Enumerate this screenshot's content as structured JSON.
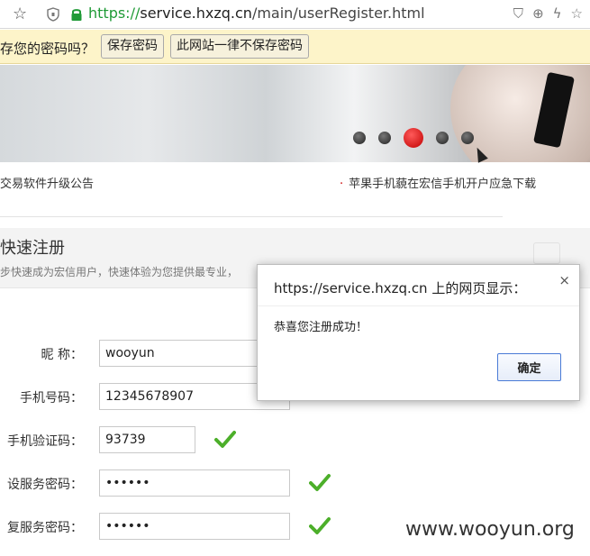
{
  "browser": {
    "url_scheme": "https://",
    "url_host": "service.hxzq.cn",
    "url_path": "/main/userRegister.html",
    "icons": [
      "star-icon",
      "shield-icon",
      "lock-icon",
      "reader-shield-icon",
      "zoom-icon",
      "bolt-icon",
      "bookmark-star-icon"
    ]
  },
  "password_bar": {
    "question": "存您的密码吗？",
    "save_label": "保存密码",
    "never_label": "此网站一律不保存密码"
  },
  "banner": {
    "slides": 5,
    "active_slide_index": 2
  },
  "notices": {
    "left": "交易软件升级公告",
    "right": "苹果手机藐在宏信手机开户应急下载"
  },
  "section": {
    "title": "快速注册",
    "subtitle": "步快速成为宏信用户，快速体验为您提供最专业，"
  },
  "form": {
    "nickname_label": "昵 称：",
    "nickname_value": "wooyun",
    "phone_label": "手机号码：",
    "phone_value": "12345678907",
    "code_label": "手机验证码：",
    "code_value": "93739",
    "pwd_label": "设服务密码：",
    "pwd_value": "••••••",
    "pwd2_label": "复服务密码：",
    "pwd2_value": "••••••"
  },
  "dialog": {
    "title": "https://service.hxzq.cn 上的网页显示：",
    "message": "恭喜您注册成功！",
    "ok_label": "确定",
    "close_glyph": "×"
  },
  "watermark": "www.wooyun.org",
  "colors": {
    "https_green": "#1f9a36",
    "check_green": "#4caf2a",
    "active_dot_red": "#e10000",
    "password_bar_bg": "#fdf4c9"
  }
}
